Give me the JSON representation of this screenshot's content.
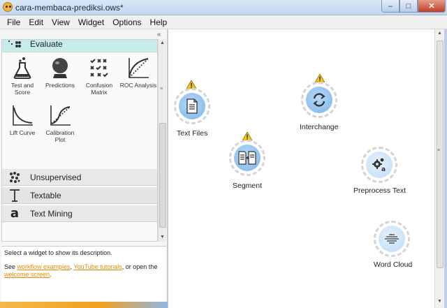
{
  "window": {
    "title": "cara-membaca-prediksi.ows*"
  },
  "menu": [
    "File",
    "Edit",
    "View",
    "Widget",
    "Options",
    "Help"
  ],
  "dock": {
    "collapse_glyph": "«",
    "categories": [
      {
        "name": "Evaluate",
        "icon": "evaluate-icon",
        "color": "#c5ece9"
      },
      {
        "name": "Unsupervised",
        "icon": "unsupervised-icon"
      },
      {
        "name": "Textable",
        "icon": "textable-icon"
      },
      {
        "name": "Text Mining",
        "icon": "text-mining-icon"
      }
    ],
    "evaluate_widgets": [
      {
        "label": "Test and Score",
        "icon": "flask-icon"
      },
      {
        "label": "Predictions",
        "icon": "crystal-ball-icon"
      },
      {
        "label": "Confusion Matrix",
        "icon": "confusion-matrix-icon"
      },
      {
        "label": "ROC Analysis",
        "icon": "roc-curve-icon"
      },
      {
        "label": "Lift Curve",
        "icon": "lift-curve-icon"
      },
      {
        "label": "Calibration Plot",
        "icon": "calibration-plot-icon"
      }
    ],
    "description": {
      "text": "Select a widget to show its description.",
      "see": "See ",
      "link1": "workflow examples",
      "comma": ", ",
      "link2": "YouTube tutorials",
      "or_open": ", or open the ",
      "link3": "welcome screen",
      "end": "."
    }
  },
  "canvas": {
    "nodes": [
      {
        "label": "Text Files",
        "icon": "document-icon",
        "warning": true
      },
      {
        "label": "Segment",
        "icon": "segment-icon",
        "warning": true
      },
      {
        "label": "Interchange",
        "icon": "interchange-icon",
        "warning": true
      },
      {
        "label": "Preprocess Text",
        "icon": "preprocess-icon",
        "warning": false
      },
      {
        "label": "Word Cloud",
        "icon": "word-cloud-icon",
        "warning": false
      }
    ]
  },
  "colors": {
    "accent": "#c5ece9",
    "node_blue": "#8ec0ee",
    "node_light": "#c9e2f9",
    "warning": "#f5c518",
    "link": "#e48a00"
  }
}
